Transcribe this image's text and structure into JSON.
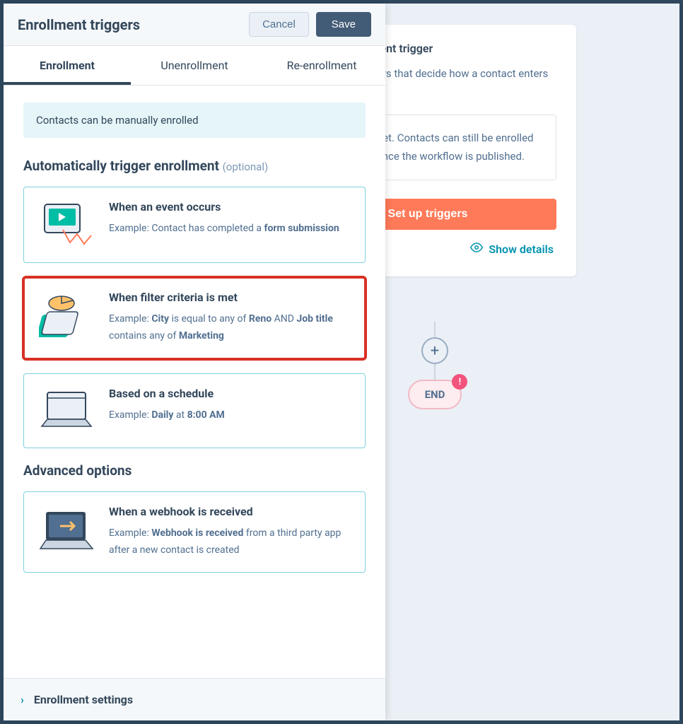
{
  "background": {
    "title": "Contact enrollment trigger",
    "description": "Choose the triggers that decide how a contact enters this workflow.",
    "notice": "No triggers set. Contacts can still be enrolled manually once the workflow is published.",
    "setup_button": "Set up triggers",
    "show_details": "Show details"
  },
  "flow": {
    "plus": "+",
    "end": "END",
    "alert": "!"
  },
  "panel": {
    "title": "Enrollment triggers",
    "cancel": "Cancel",
    "save": "Save",
    "tabs": {
      "enrollment": "Enrollment",
      "unenrollment": "Unenrollment",
      "reenrollment": "Re-enrollment"
    },
    "banner": "Contacts can be manually enrolled",
    "section_auto": "Automatically trigger enrollment",
    "optional": "(optional)",
    "section_advanced": "Advanced options",
    "footer": "Enrollment settings"
  },
  "cards": {
    "event": {
      "title": "When an event occurs",
      "prefix": "Example: Contact has completed a ",
      "bold": "form submission"
    },
    "filter": {
      "title": "When filter criteria is met",
      "p1": "Example: ",
      "b1": "City",
      "p2": " is equal to any of ",
      "b2": "Reno",
      "p3": " AND ",
      "b3": "Job title",
      "p4": " contains any of ",
      "b4": "Marketing"
    },
    "schedule": {
      "title": "Based on a schedule",
      "p1": "Example: ",
      "b1": "Daily",
      "p2": " at ",
      "b2": "8:00 AM"
    },
    "webhook": {
      "title": "When a webhook is received",
      "p1": "Example: ",
      "b1": "Webhook is received",
      "p2": " from a third party app after a new contact is created"
    }
  }
}
